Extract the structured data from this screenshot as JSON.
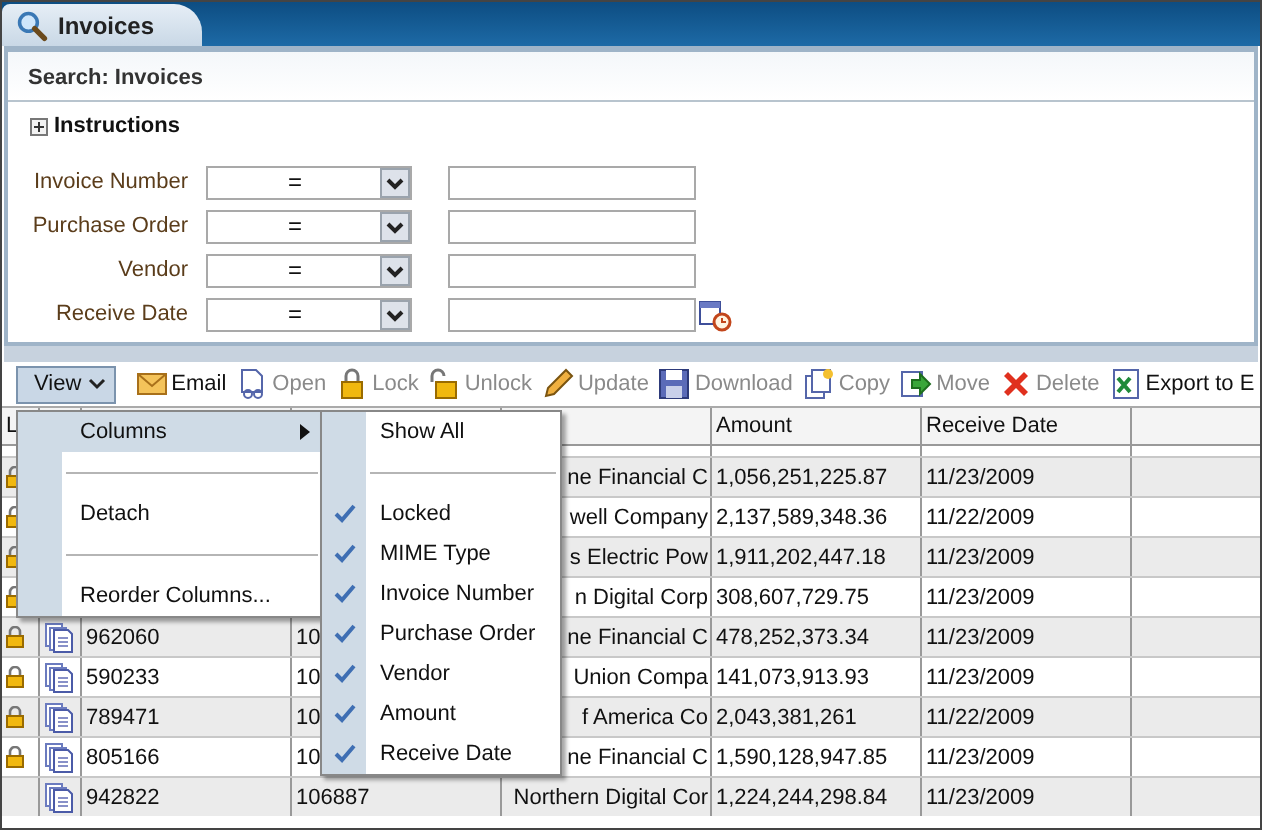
{
  "tab": {
    "label": "Invoices",
    "selected": true
  },
  "search": {
    "title": "Search: Invoices",
    "instructions": {
      "label": "Instructions",
      "expanded": false
    },
    "fields": [
      {
        "label": "Invoice Number",
        "operator": "=",
        "kind": "text"
      },
      {
        "label": "Purchase Order",
        "operator": "=",
        "kind": "text"
      },
      {
        "label": "Vendor",
        "operator": "=",
        "kind": "text"
      },
      {
        "label": "Receive Date",
        "operator": "=",
        "kind": "date"
      }
    ]
  },
  "toolbar": {
    "view": {
      "label": "View",
      "expanded": true
    },
    "actions": [
      {
        "label": "Email",
        "disabled": false
      },
      {
        "label": "Open",
        "disabled": true
      },
      {
        "label": "Lock",
        "disabled": true
      },
      {
        "label": "Unlock",
        "disabled": true
      },
      {
        "label": "Update",
        "disabled": true
      },
      {
        "label": "Download",
        "disabled": true
      },
      {
        "label": "Copy",
        "disabled": true
      },
      {
        "label": "Move",
        "disabled": true
      },
      {
        "label": "Delete",
        "disabled": true
      },
      {
        "label": "Export to E",
        "disabled": false
      }
    ]
  },
  "view_menu": {
    "items": [
      {
        "label": "Columns",
        "selected": true,
        "kind": "submenu"
      },
      {
        "label": "Detach",
        "selected": false,
        "kind": "action"
      },
      {
        "label": "Reorder Columns...",
        "selected": false,
        "kind": "action"
      }
    ]
  },
  "columns_menu": {
    "items": [
      {
        "label": "Show All",
        "kind": "action"
      },
      {
        "label": "Locked",
        "kind": "toggle",
        "checked": true
      },
      {
        "label": "MIME Type",
        "kind": "toggle",
        "checked": true
      },
      {
        "label": "Invoice Number",
        "kind": "toggle",
        "checked": true
      },
      {
        "label": "Purchase Order",
        "kind": "toggle",
        "checked": true
      },
      {
        "label": "Vendor",
        "kind": "toggle",
        "checked": true
      },
      {
        "label": "Amount",
        "kind": "toggle",
        "checked": true
      },
      {
        "label": "Receive Date",
        "kind": "toggle",
        "checked": true
      }
    ]
  },
  "table": {
    "header": {
      "column_1": "L",
      "amount": "Amount",
      "receive_date": "Receive Date"
    },
    "rows": [
      {
        "locked": true,
        "column_5": "ne Financial C",
        "amount": "1,056,251,225.87",
        "receive_date": "11/23/2009"
      },
      {
        "locked": true,
        "column_5": "well Company",
        "amount": "2,137,589,348.36",
        "receive_date": "11/22/2009"
      },
      {
        "locked": true,
        "column_5": "s Electric Pow",
        "amount": "1,911,202,447.18",
        "receive_date": "11/23/2009"
      },
      {
        "locked": true,
        "column_5": "n Digital Corp",
        "amount": "308,607,729.75",
        "receive_date": "11/23/2009"
      },
      {
        "locked": true,
        "column_3": "962060",
        "column_4": "10",
        "column_5": "ne Financial C",
        "amount": "478,252,373.34",
        "receive_date": "11/23/2009"
      },
      {
        "locked": true,
        "column_3": "590233",
        "column_4": "10",
        "column_5": "Union Compa",
        "amount": "141,073,913.93",
        "receive_date": "11/23/2009"
      },
      {
        "locked": true,
        "column_3": "789471",
        "column_4": "10",
        "column_5": "f America Co",
        "amount": "2,043,381,261",
        "receive_date": "11/22/2009"
      },
      {
        "locked": true,
        "column_3": "805166",
        "column_4": "10",
        "column_5": "ne Financial C",
        "amount": "1,590,128,947.85",
        "receive_date": "11/23/2009"
      },
      {
        "locked": false,
        "column_3": "942822",
        "column_4": "106887",
        "column_5": "Northern Digital Cor",
        "amount": "1,224,244,298.84",
        "receive_date": "11/23/2009"
      }
    ]
  }
}
